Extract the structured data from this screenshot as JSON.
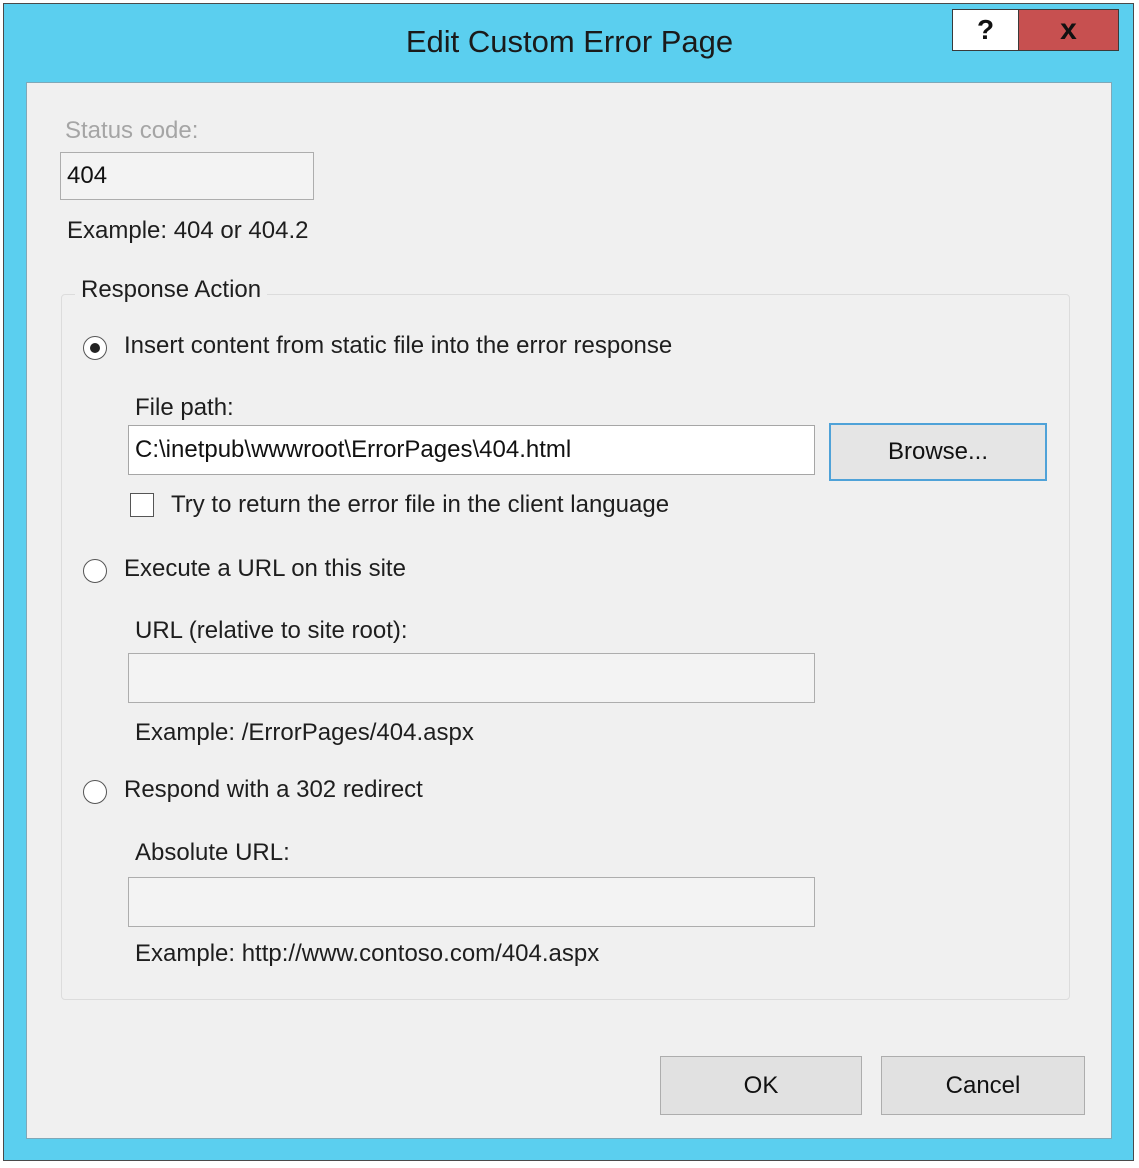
{
  "dialog": {
    "title": "Edit Custom Error Page",
    "help_label": "?",
    "close_label": "x"
  },
  "status": {
    "label": "Status code:",
    "value": "404",
    "example": "Example: 404 or 404.2"
  },
  "response_action": {
    "group_label": "Response Action",
    "options": [
      {
        "label": "Insert content from static file into the error response",
        "selected": true
      },
      {
        "label": "Execute a URL on this site",
        "selected": false
      },
      {
        "label": "Respond with a 302 redirect",
        "selected": false
      }
    ],
    "file_path": {
      "label": "File path:",
      "value": "C:\\inetpub\\wwwroot\\ErrorPages\\404.html",
      "browse_label": "Browse...",
      "client_language_label": "Try to return the error file in the client language",
      "client_language_checked": false
    },
    "url": {
      "label": "URL (relative to site root):",
      "value": "",
      "example": "Example: /ErrorPages/404.aspx"
    },
    "redirect": {
      "label": "Absolute URL:",
      "value": "",
      "example": "Example: http://www.contoso.com/404.aspx"
    }
  },
  "footer": {
    "ok_label": "OK",
    "cancel_label": "Cancel"
  }
}
